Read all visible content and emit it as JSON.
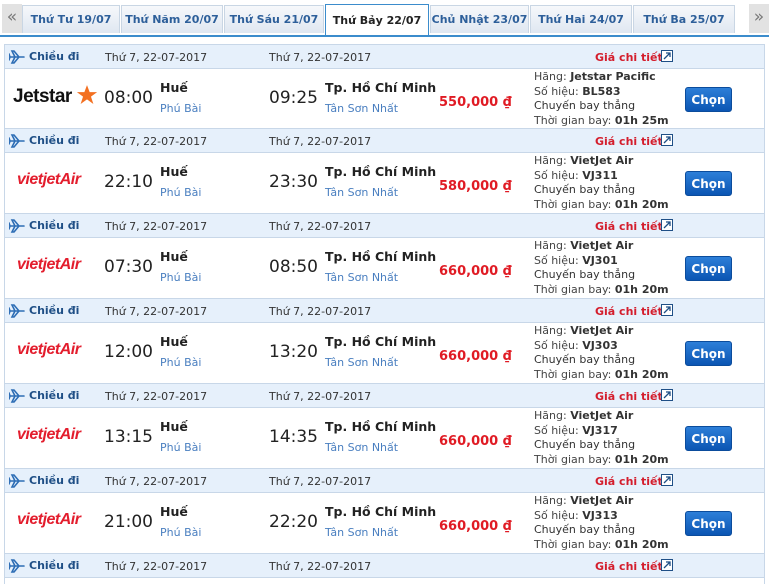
{
  "tabs": [
    {
      "label": "Thứ Tư 19/07"
    },
    {
      "label": "Thứ Năm 20/07"
    },
    {
      "label": "Thứ Sáu 21/07"
    },
    {
      "label": "Thứ Bảy 22/07",
      "active": true
    },
    {
      "label": "Chủ Nhật 23/07"
    },
    {
      "label": "Thứ Hai 24/07"
    },
    {
      "label": "Thứ Ba 25/07"
    }
  ],
  "nav": {
    "prev": "«",
    "next": "»"
  },
  "common": {
    "direction": "Chiều đi",
    "date": "Thứ 7, 22-07-2017",
    "price_detail": "Giá chi tiết",
    "airline_label": "Hãng:",
    "flight_no_label": "Số hiệu:",
    "type": "Chuyến bay thẳng",
    "duration_label": "Thời gian bay:",
    "select": "Chọn",
    "from_city": "Huế",
    "from_airport": "Phú Bài",
    "to_city": "Tp. Hồ Chí Minh",
    "to_airport": "Tân Sơn Nhất"
  },
  "flights": [
    {
      "logo": "jetstar",
      "airline": "Jetstar Pacific",
      "flight_no": "BL583",
      "depart": "08:00",
      "arrive": "09:25",
      "price": "550,000 ₫",
      "duration": "01h 25m"
    },
    {
      "logo": "vietjet",
      "airline": "VietJet Air",
      "flight_no": "VJ311",
      "depart": "22:10",
      "arrive": "23:30",
      "price": "580,000 ₫",
      "duration": "01h 20m"
    },
    {
      "logo": "vietjet",
      "airline": "VietJet Air",
      "flight_no": "VJ301",
      "depart": "07:30",
      "arrive": "08:50",
      "price": "660,000 ₫",
      "duration": "01h 20m"
    },
    {
      "logo": "vietjet",
      "airline": "VietJet Air",
      "flight_no": "VJ303",
      "depart": "12:00",
      "arrive": "13:20",
      "price": "660,000 ₫",
      "duration": "01h 20m"
    },
    {
      "logo": "vietjet",
      "airline": "VietJet Air",
      "flight_no": "VJ317",
      "depart": "13:15",
      "arrive": "14:35",
      "price": "660,000 ₫",
      "duration": "01h 20m"
    },
    {
      "logo": "vietjet",
      "airline": "VietJet Air",
      "flight_no": "VJ313",
      "depart": "21:00",
      "arrive": "22:20",
      "price": "660,000 ₫",
      "duration": "01h 20m"
    }
  ],
  "logos": {
    "jetstar_text": "Jetstar",
    "vietjet_text": "vietjetAir"
  },
  "colors": {
    "accent": "#3b8ccc",
    "price": "#e01b24",
    "button": "#0b55b3",
    "header_bg": "#e6f0fb"
  }
}
